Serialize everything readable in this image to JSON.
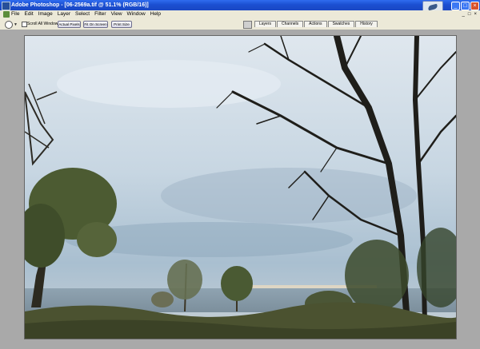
{
  "window": {
    "title": "Adobe Photoshop - [06-2569a.tif @ 51.1% (RGB/16)]"
  },
  "menu": [
    "File",
    "Edit",
    "Image",
    "Layer",
    "Select",
    "Filter",
    "View",
    "Window",
    "Help"
  ],
  "options": {
    "scroll_all_label": "Scroll All Windows",
    "buttons": [
      "Actual Pixels",
      "Fit On Screen",
      "Print Size"
    ]
  },
  "palette_tabs": [
    "Layers",
    "Channels",
    "Actions",
    "Swatches",
    "History"
  ],
  "icons": {
    "app": "photoshop-app-icon",
    "logo": "photoshop-feather-logo",
    "tool": "zoom-tool-icon",
    "palette_well": "palette-well-icon"
  }
}
